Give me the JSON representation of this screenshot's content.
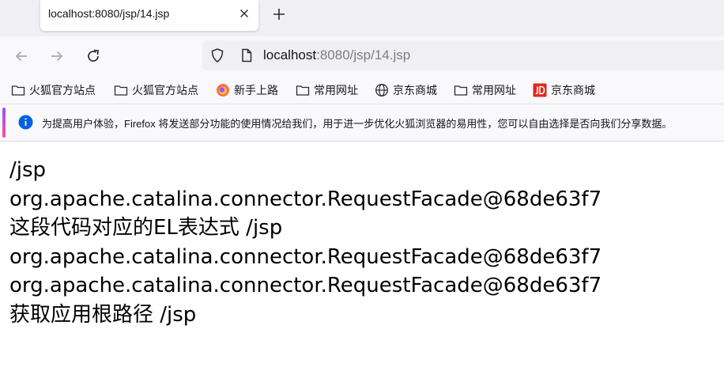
{
  "browser": {
    "tab": {
      "title": "localhost:8080/jsp/14.jsp"
    },
    "url": {
      "host": "localhost",
      "rest": ":8080/jsp/14.jsp"
    },
    "bookmarks": [
      {
        "label": "火狐官方站点",
        "icon": "folder-icon"
      },
      {
        "label": "火狐官方站点",
        "icon": "folder-icon"
      },
      {
        "label": "新手上路",
        "icon": "firefox-icon"
      },
      {
        "label": "常用网址",
        "icon": "folder-icon"
      },
      {
        "label": "京东商城",
        "icon": "globe-icon"
      },
      {
        "label": "常用网址",
        "icon": "folder-icon"
      },
      {
        "label": "京东商城",
        "icon": "jd-icon"
      }
    ],
    "infobar": {
      "text": "为提高用户体验，Firefox 将发送部分功能的使用情况给我们，用于进一步优化火狐浏览器的易用性，您可以自由选择是否向我们分享数据。",
      "accent_colors": [
        "#9059ff",
        "#ff4aa2"
      ],
      "info_color": "#0060df"
    }
  },
  "page": {
    "lines": [
      "/jsp",
      "org.apache.catalina.connector.RequestFacade@68de63f7",
      "这段代码对应的EL表达式 /jsp",
      "org.apache.catalina.connector.RequestFacade@68de63f7",
      "org.apache.catalina.connector.RequestFacade@68de63f7",
      "获取应用根路径 /jsp"
    ]
  }
}
